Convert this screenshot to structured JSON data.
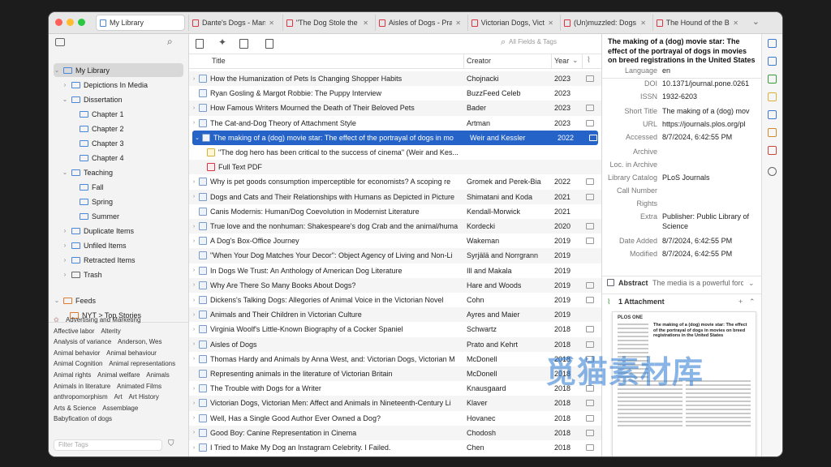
{
  "colors": {
    "accent": "#2563c9",
    "close": "#fe5f57",
    "minimize": "#febc2e",
    "zoom": "#28c840"
  },
  "tabs": [
    {
      "label": "My Library",
      "active": true
    },
    {
      "label": "Dante's Dogs - Man",
      "active": false
    },
    {
      "label": "\"The Dog Stole the l",
      "active": false
    },
    {
      "label": "Aisles of Dogs - Pra",
      "active": false
    },
    {
      "label": "Victorian Dogs, Victo",
      "active": false
    },
    {
      "label": "(Un)muzzled: Dogs",
      "active": false
    },
    {
      "label": "The Hound of the Ba",
      "active": false
    }
  ],
  "collections": [
    {
      "label": "My Library",
      "level": 0,
      "selected": true
    },
    {
      "label": "Depictions In Media",
      "level": 1
    },
    {
      "label": "Dissertation",
      "level": 1
    },
    {
      "label": "Chapter 1",
      "level": 2
    },
    {
      "label": "Chapter 2",
      "level": 2
    },
    {
      "label": "Chapter 3",
      "level": 2
    },
    {
      "label": "Chapter 4",
      "level": 2
    },
    {
      "label": "Teaching",
      "level": 1
    },
    {
      "label": "Fall",
      "level": 2
    },
    {
      "label": "Spring",
      "level": 2
    },
    {
      "label": "Summer",
      "level": 2
    },
    {
      "label": "Duplicate Items",
      "level": 1
    },
    {
      "label": "Unfiled Items",
      "level": 1
    },
    {
      "label": "Retracted Items",
      "level": 1
    },
    {
      "label": "Trash",
      "level": 1
    }
  ],
  "feeds": {
    "label": "Feeds",
    "items": [
      "NYT > Top Stories"
    ]
  },
  "tags": [
    "Advertising and Marketing",
    "Affective labor",
    "Alterity",
    "Analysis of variance",
    "Anderson, Wes",
    "Animal behavior",
    "Animal behaviour",
    "Animal Cognition",
    "Animal representations",
    "Animal rights",
    "Animal welfare",
    "Animals",
    "Animals in literature",
    "Animated Films",
    "anthropomorphism",
    "Art",
    "Art History",
    "Arts & Science",
    "Assemblage",
    "Babyfication of dogs"
  ],
  "filter_tags_placeholder": "Filter Tags",
  "search_placeholder": "All Fields & Tags",
  "columns": {
    "title": "Title",
    "creator": "Creator",
    "year": "Year"
  },
  "items": [
    {
      "title": "How the Humanization of Pets Is Changing Shopper Habits",
      "creator": "Chojnacki",
      "year": "2023",
      "chev": true,
      "icon": "doc",
      "attach": true
    },
    {
      "title": "Ryan Gosling & Margot Robbie: The Puppy Interview",
      "creator": "BuzzFeed Celeb",
      "year": "2023",
      "chev": false,
      "icon": "doc",
      "attach": false
    },
    {
      "title": "How Famous Writers Mourned the Death of Their Beloved Pets",
      "creator": "Bader",
      "year": "2023",
      "chev": true,
      "icon": "doc",
      "attach": true
    },
    {
      "title": "The Cat-and-Dog Theory of Attachment Style",
      "creator": "Artman",
      "year": "2023",
      "chev": true,
      "icon": "doc",
      "attach": true
    },
    {
      "title": "The making of a (dog) movie star: The effect of the portrayal of dogs in mo",
      "creator": "Weir and Kessler",
      "year": "2022",
      "chev": true,
      "icon": "doc",
      "attach": true,
      "selected": true
    },
    {
      "title": "\"The dog hero has been critical to the success of cinema\" (Weir and Kes...",
      "creator": "",
      "year": "",
      "chev": false,
      "icon": "note",
      "attach": false,
      "child": true
    },
    {
      "title": "Full Text PDF",
      "creator": "",
      "year": "",
      "chev": false,
      "icon": "pdf",
      "attach": false,
      "child": true
    },
    {
      "title": "Why is pet goods consumption imperceptible for economists? A scoping re",
      "creator": "Gromek and Perek-Bia",
      "year": "2022",
      "chev": true,
      "icon": "doc",
      "attach": true
    },
    {
      "title": "Dogs and Cats and Their Relationships with Humans as Depicted in Picture",
      "creator": "Shimatani and Koda",
      "year": "2021",
      "chev": true,
      "icon": "doc",
      "attach": true
    },
    {
      "title": "Canis Modernis: Human/Dog Coevolution in Modernist Literature",
      "creator": "Kendall-Morwick",
      "year": "2021",
      "chev": false,
      "icon": "doc",
      "attach": false
    },
    {
      "title": "True love and the nonhuman: Shakespeare's dog Crab and the animal/huma",
      "creator": "Kordecki",
      "year": "2020",
      "chev": true,
      "icon": "doc",
      "attach": true
    },
    {
      "title": "A Dog's Box-Office Journey",
      "creator": "Wakeman",
      "year": "2019",
      "chev": true,
      "icon": "doc",
      "attach": true
    },
    {
      "title": "\"When Your Dog Matches Your Decor\": Object Agency of Living and Non-Li",
      "creator": "Syrjälä and Norrgrann",
      "year": "2019",
      "chev": false,
      "icon": "doc",
      "attach": false
    },
    {
      "title": "In Dogs We Trust: An Anthology of American Dog Literature",
      "creator": "Ill and Makala",
      "year": "2019",
      "chev": true,
      "icon": "doc",
      "attach": false
    },
    {
      "title": "Why Are There So Many Books About Dogs?",
      "creator": "Hare and Woods",
      "year": "2019",
      "chev": true,
      "icon": "doc",
      "attach": true
    },
    {
      "title": "Dickens's Talking Dogs: Allegories of Animal Voice in the Victorian Novel",
      "creator": "Cohn",
      "year": "2019",
      "chev": true,
      "icon": "doc",
      "attach": true
    },
    {
      "title": "Animals and Their Children in Victorian Culture",
      "creator": "Ayres and Maier",
      "year": "2019",
      "chev": true,
      "icon": "doc",
      "attach": false
    },
    {
      "title": "Virginia Woolf's Little-Known Biography of a Cocker Spaniel",
      "creator": "Schwartz",
      "year": "2018",
      "chev": true,
      "icon": "doc",
      "attach": true
    },
    {
      "title": "Aisles of Dogs",
      "creator": "Prato and Kehrt",
      "year": "2018",
      "chev": true,
      "icon": "doc",
      "attach": true
    },
    {
      "title": "Thomas Hardy and Animals by Anna West, and: Victorian Dogs, Victorian M",
      "creator": "McDonell",
      "year": "2018",
      "chev": true,
      "icon": "doc",
      "attach": true
    },
    {
      "title": "Representing animals in the literature of Victorian Britain",
      "creator": "McDonell",
      "year": "2018",
      "chev": false,
      "icon": "doc",
      "attach": false
    },
    {
      "title": "The Trouble with Dogs for a Writer",
      "creator": "Knausgaard",
      "year": "2018",
      "chev": true,
      "icon": "doc",
      "attach": true
    },
    {
      "title": "Victorian Dogs, Victorian Men: Affect and Animals in Nineteenth-Century Li",
      "creator": "Klaver",
      "year": "2018",
      "chev": true,
      "icon": "doc",
      "attach": true
    },
    {
      "title": "Well, Has a Single Good Author Ever Owned a Dog?",
      "creator": "Hovanec",
      "year": "2018",
      "chev": true,
      "icon": "doc",
      "attach": true
    },
    {
      "title": "Good Boy: Canine Representation in Cinema",
      "creator": "Chodosh",
      "year": "2018",
      "chev": true,
      "icon": "doc",
      "attach": true
    },
    {
      "title": "I Tried to Make My Dog an Instagram Celebrity. I Failed.",
      "creator": "Chen",
      "year": "2018",
      "chev": true,
      "icon": "doc",
      "attach": true
    }
  ],
  "detail": {
    "title": "The making of a (dog) movie star: The effect of the portrayal of dogs in movies on breed registrations in the United States",
    "fields": [
      {
        "label": "Language",
        "value": "en"
      },
      {
        "label": "DOI",
        "value": "10.1371/journal.pone.0261"
      },
      {
        "label": "ISSN",
        "value": "1932-6203"
      },
      {
        "label": "Short Title",
        "value": "The making of a (dog) mov"
      },
      {
        "label": "URL",
        "value": "https://journals.plos.org/pl"
      },
      {
        "label": "Accessed",
        "value": "8/7/2024, 6:42:55 PM"
      },
      {
        "label": "Archive",
        "value": ""
      },
      {
        "label": "Loc. in Archive",
        "value": ""
      },
      {
        "label": "Library Catalog",
        "value": "PLoS Journals"
      },
      {
        "label": "Call Number",
        "value": ""
      },
      {
        "label": "Rights",
        "value": ""
      },
      {
        "label": "Extra",
        "value": "Publisher: Public Library of"
      },
      {
        "label": "",
        "value": "Science"
      },
      {
        "label": "Date Added",
        "value": "8/7/2024, 6:42:55 PM"
      },
      {
        "label": "Modified",
        "value": "8/7/2024, 6:42:55 PM"
      }
    ],
    "abstract_label": "Abstract",
    "abstract_preview": "The media is a powerful force",
    "attachments_label": "1 Attachment",
    "preview_journal": "PLOS ONE",
    "preview_heading": "The making of a (dog) movie star: The effect of the portrayal of dogs in movies on breed registrations in the United States"
  },
  "watermark": "觅猫素材库"
}
